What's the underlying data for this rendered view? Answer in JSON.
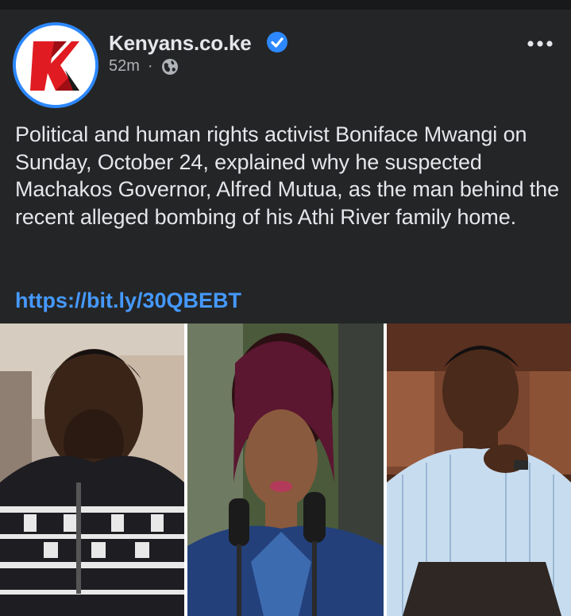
{
  "post": {
    "page_name": "Kenyans.co.ke",
    "timestamp": "52m",
    "separator": "·",
    "privacy_icon": "globe-icon",
    "verified_icon": "verified-badge-icon",
    "more_icon": "more-options-icon",
    "avatar_letter": "K",
    "body": "Political and human rights activist Boniface Mwangi on Sunday, October 24, explained why he suspected Machakos Governor, Alfred Mutua, as the man behind the recent alleged bombing of his Athi River family home.",
    "link": "https://bit.ly/30QBEBT"
  },
  "photos": [
    {
      "name": "photo-man-patterned-sweater"
    },
    {
      "name": "photo-woman-at-microphones"
    },
    {
      "name": "photo-man-smiling-seated"
    }
  ],
  "colors": {
    "background": "#242526",
    "text": "#e4e6eb",
    "secondary_text": "#b0b3b8",
    "link": "#4599ff",
    "verified": "#2d88ff",
    "brand_red": "#e11b22"
  }
}
